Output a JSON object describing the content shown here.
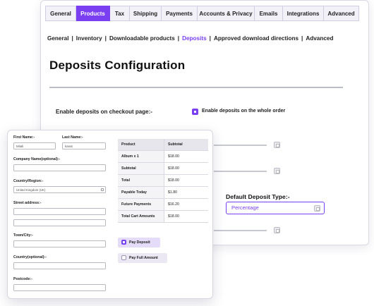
{
  "tabs": [
    "General",
    "Products",
    "Tax",
    "Shipping",
    "Payments",
    "Accounts & Privacy",
    "Emails",
    "Integrations",
    "Advanced"
  ],
  "active_tab": "Products",
  "subnav": [
    "General",
    "Inventory",
    "Downloadable products",
    "Deposits",
    "Approved download directions",
    "Advanced"
  ],
  "active_subnav": "Deposits",
  "page_title": "Deposits Configuration",
  "option": {
    "label": "Enable deposits on checkout page:-",
    "checkbox_text": "Enable deposits on the whole order"
  },
  "deposit_type": {
    "label": "Default Deposit Type:-",
    "value": "Percentage"
  },
  "checkout": {
    "first_name_label": "First Name:-",
    "first_name_value": "Mitali",
    "last_name_label": "Last Name:-",
    "last_name_value": "kanat",
    "company_label": "Company Name(optional):-",
    "country_label": "Country/Region:-",
    "country_value": "United Kingdom (UK)",
    "street_label": "Street address:-",
    "town_label": "Town/City:-",
    "county_label": "Country(optional):-",
    "postcode_label": "Postcode:-"
  },
  "cart": {
    "headers": [
      "Product",
      "Subtotal"
    ],
    "rows": [
      [
        "Album x 1",
        "$18.00"
      ],
      [
        "Subtotal",
        "$18.00"
      ],
      [
        "Total",
        "$18.00"
      ],
      [
        "Payable Today",
        "$1.80"
      ],
      [
        "Future Payments",
        "$16.20"
      ],
      [
        "Total Cart Amounts",
        "$18.00"
      ]
    ]
  },
  "buttons": {
    "pay_deposit": "Pay Deposit",
    "pay_full": "Pay Full Amount"
  },
  "colors": {
    "accent": "#7b3ff2",
    "pay_deposit_bg": "#e4dcf8",
    "pay_full_bg": "#ebe8f4"
  }
}
